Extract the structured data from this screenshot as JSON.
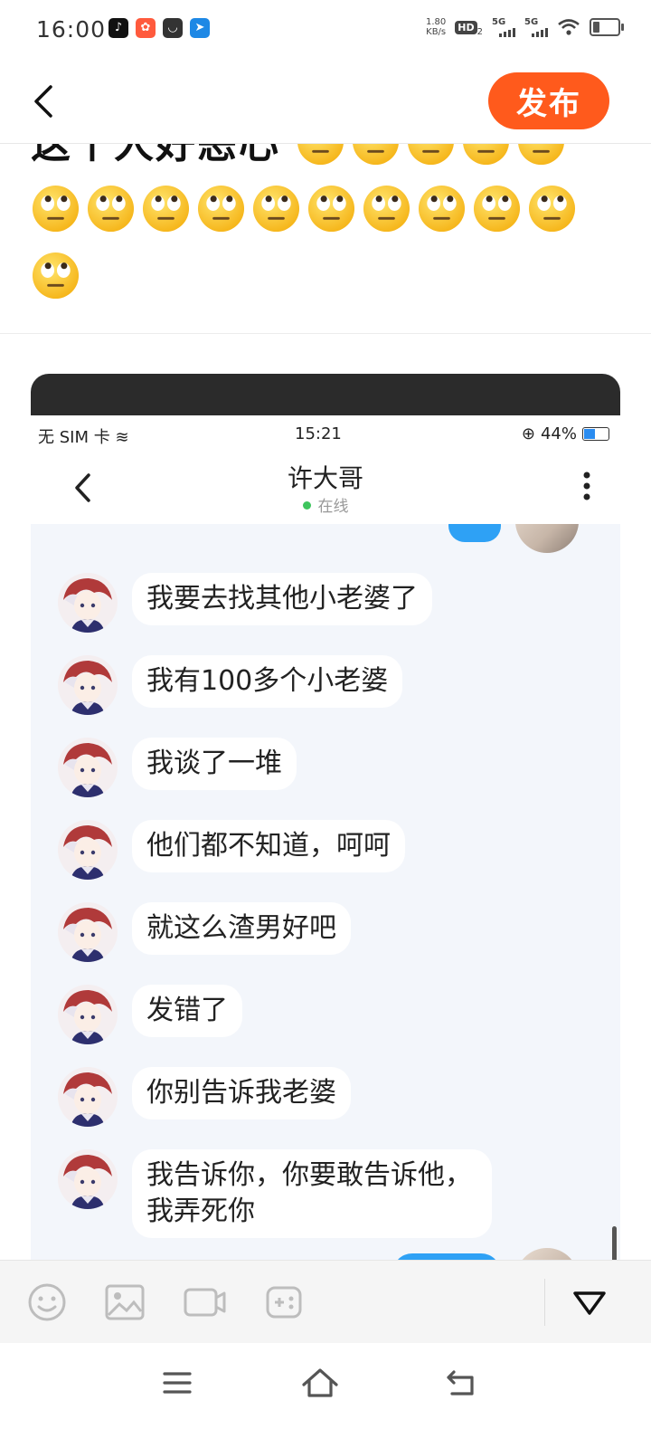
{
  "status_bar": {
    "time": "16:00",
    "net_speed_value": "1.80",
    "net_speed_unit": "KB/s",
    "hd_label": "HD",
    "hd_sub": "2",
    "sim1_label": "5G",
    "sim2_label": "5G",
    "app_icons": [
      "tiktok-icon",
      "kuaishou-icon",
      "app-icon",
      "flag-app-icon"
    ]
  },
  "top_bar": {
    "publish_label": "发布",
    "accent_color": "#ff5a1c"
  },
  "post": {
    "text": "这个人好恶心",
    "emoji_count": 16,
    "emoji_name": "rolling-eyes-emoji"
  },
  "screenshot": {
    "status": {
      "sim": "无 SIM 卡",
      "time": "15:21",
      "battery": "44%"
    },
    "header": {
      "contact_name": "许大哥",
      "status": "在线"
    },
    "messages": [
      {
        "text": "我要去找其他小老婆了"
      },
      {
        "text": "我有100多个小老婆"
      },
      {
        "text": "我谈了一堆"
      },
      {
        "text": "他们都不知道，呵呵"
      },
      {
        "text": "就这么渣男好吧"
      },
      {
        "text": "发错了"
      },
      {
        "text": "你别告诉我老婆"
      },
      {
        "text_line1": "我告诉你，你要敢告诉他，",
        "text_line2": "我弄死你"
      }
    ],
    "sent_bubble_color": "#2ea1f5"
  },
  "toolbar": {
    "icons": [
      "emoji-icon",
      "image-icon",
      "video-icon",
      "game-icon",
      "collapse-icon"
    ]
  },
  "system_nav": {
    "icons": [
      "menu-icon",
      "home-icon",
      "back-icon"
    ]
  }
}
